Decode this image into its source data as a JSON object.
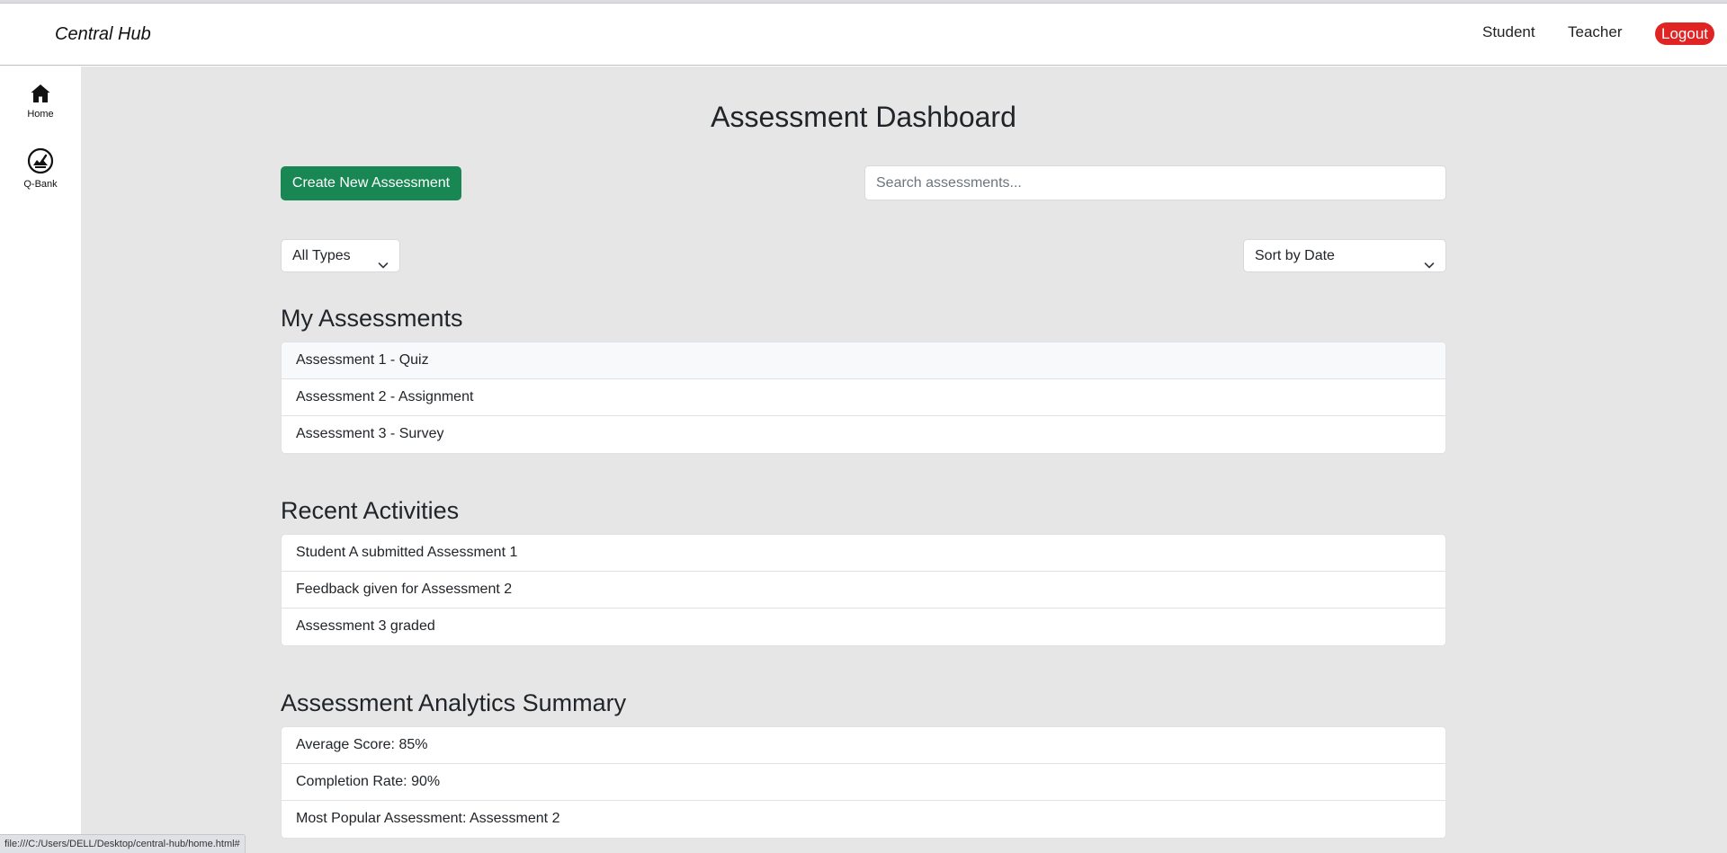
{
  "navbar": {
    "brand": "Central Hub",
    "links": [
      "Student",
      "Teacher"
    ],
    "logout_label": "Logout"
  },
  "sidebar": {
    "items": [
      {
        "label": "Home",
        "icon": "home-icon"
      },
      {
        "label": "Q-Bank",
        "icon": "gauge-icon"
      }
    ]
  },
  "main": {
    "title": "Assessment Dashboard",
    "create_label": "Create New Assessment",
    "search_placeholder": "Search assessments...",
    "type_filter": "All Types",
    "sort_filter": "Sort by Date"
  },
  "sections": {
    "my_assessments": {
      "title": "My Assessments",
      "items": [
        "Assessment 1 - Quiz",
        "Assessment 2 - Assignment",
        "Assessment 3 - Survey"
      ]
    },
    "recent_activities": {
      "title": "Recent Activities",
      "items": [
        "Student A submitted Assessment 1",
        "Feedback given for Assessment 2",
        "Assessment 3 graded"
      ]
    },
    "analytics": {
      "title": "Assessment Analytics Summary",
      "items": [
        "Average Score: 85%",
        "Completion Rate: 90%",
        "Most Popular Assessment: Assessment 2"
      ]
    }
  },
  "statusbar": {
    "url": "file:///C:/Users/DELL/Desktop/central-hub/home.html#"
  },
  "colors": {
    "create_button": "#198754",
    "logout_button": "#e02424",
    "main_background": "#e6e6e6"
  }
}
